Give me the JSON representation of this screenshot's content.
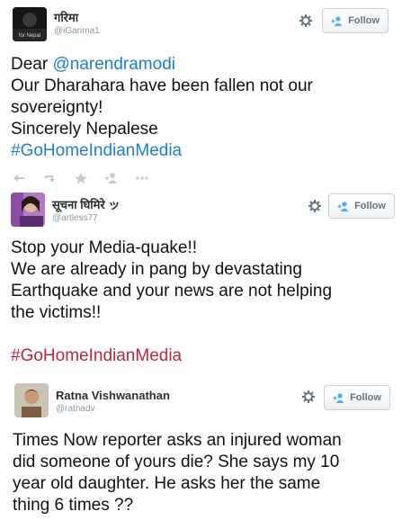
{
  "tweets": [
    {
      "name": "गरिमा",
      "handle": "@iGarima1",
      "avatar_text": "for Nepal",
      "follow_label": "Follow",
      "lines": [
        {
          "parts": [
            {
              "t": "Dear "
            },
            {
              "t": "@narendramodi",
              "c": "mention"
            }
          ]
        },
        {
          "parts": [
            {
              "t": "Our Dharahara have been fallen not our"
            }
          ]
        },
        {
          "parts": [
            {
              "t": "sovereignty!"
            }
          ]
        },
        {
          "parts": [
            {
              "t": "Sincerely Nepalese"
            }
          ]
        },
        {
          "parts": [
            {
              "t": " #GoHomeIndianMedia",
              "c": "hashtag"
            }
          ]
        }
      ]
    },
    {
      "name": "सूचना घिमिरे ッ",
      "handle": "@artless77",
      "follow_label": "Follow",
      "lines": [
        {
          "parts": [
            {
              "t": "Stop your Media-quake!!"
            }
          ]
        },
        {
          "parts": [
            {
              "t": "We are already in pang by devastating"
            }
          ]
        },
        {
          "parts": [
            {
              "t": "Earthquake and your news are not helping"
            }
          ]
        },
        {
          "parts": [
            {
              "t": "the victims!!"
            }
          ]
        },
        {
          "parts": [
            {
              "t": ""
            }
          ]
        },
        {
          "parts": [
            {
              "t": "#GoHomeIndianMedia",
              "c": "hashtag-red"
            }
          ]
        }
      ]
    },
    {
      "name": "Ratna Vishwanathan",
      "handle": "@ratnadv",
      "follow_label": "Follow",
      "lines": [
        {
          "parts": [
            {
              "t": "Times Now reporter asks an injured woman"
            }
          ]
        },
        {
          "parts": [
            {
              "t": "did someone of yours die? She says my 10"
            }
          ]
        },
        {
          "parts": [
            {
              "t": "year old daughter. He asks her the same"
            }
          ]
        },
        {
          "parts": [
            {
              "t": "thing  6 times ??"
            }
          ]
        }
      ]
    }
  ],
  "actions": [
    "reply-icon",
    "retweet-icon",
    "favorite-icon",
    "follow-icon",
    "more-icon"
  ],
  "colors": {
    "link": "#1d7ecc",
    "hashtag_red": "#b8273a",
    "muted": "#8899a6",
    "follow_border": "#c6d0d6"
  }
}
